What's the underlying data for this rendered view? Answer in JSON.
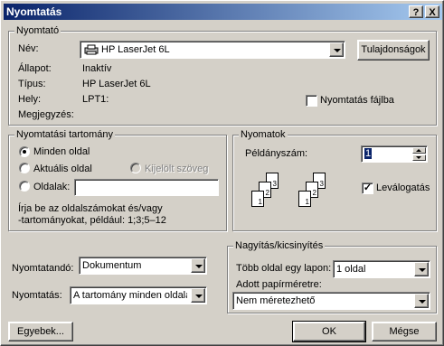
{
  "window": {
    "title": "Nyomtatás",
    "help_button": "?",
    "close_button": "X"
  },
  "printer": {
    "group_label": "Nyomtató",
    "name_label": "Név:",
    "name_value": "HP LaserJet 6L",
    "properties_button": "Tulajdonságok",
    "status_label": "Állapot:",
    "status_value": "Inaktív",
    "type_label": "Típus:",
    "type_value": "HP LaserJet 6L",
    "where_label": "Hely:",
    "where_value": "LPT1:",
    "comment_label": "Megjegyzés:",
    "print_to_file_label": "Nyomtatás fájlba",
    "print_to_file_checked": false
  },
  "range": {
    "group_label": "Nyomtatási tartomány",
    "all_label": "Minden oldal",
    "current_label": "Aktuális oldal",
    "selection_label": "Kijelölt szöveg",
    "pages_label": "Oldalak:",
    "pages_value": "",
    "selected": "all",
    "hint_line1": "Írja be az oldalszámokat és/vagy",
    "hint_line2": "-tartományokat, például: 1;3;5–12"
  },
  "copies": {
    "group_label": "Nyomatok",
    "count_label": "Példányszám:",
    "count_value": "1",
    "collate_label": "Leválogatás",
    "collate_checked": true,
    "page_numbers": [
      "1",
      "2",
      "3"
    ]
  },
  "print_what": {
    "label": "Nyomtatandó:",
    "value": "Dokumentum"
  },
  "print_sel": {
    "label": "Nyomtatás:",
    "value": "A tartomány minden oldala"
  },
  "zoom": {
    "group_label": "Nagyítás/kicsinyítés",
    "pages_per_sheet_label": "Több oldal egy lapon:",
    "pages_per_sheet_value": "1 oldal",
    "scale_label": "Adott papírméretre:",
    "scale_value": "Nem méretezhető"
  },
  "buttons": {
    "options": "Egyebek...",
    "ok": "OK",
    "cancel": "Mégse"
  }
}
